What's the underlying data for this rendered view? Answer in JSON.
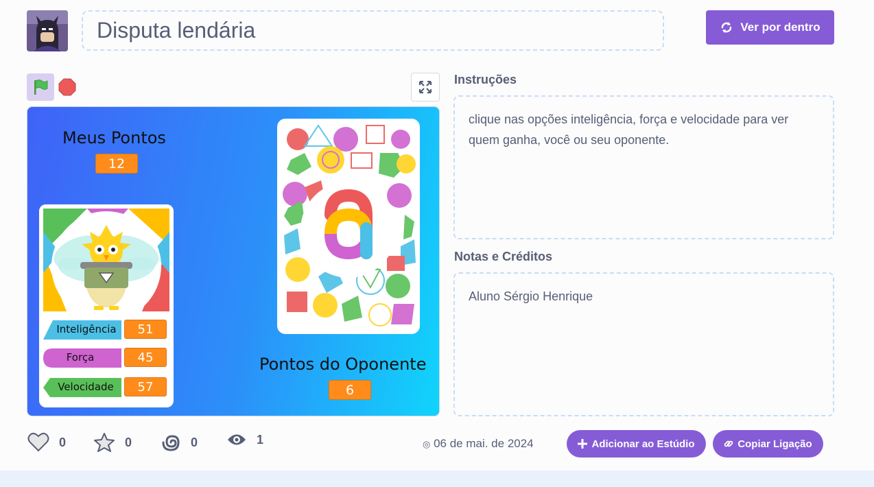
{
  "project": {
    "title": "Disputa lendária",
    "see_inside_label": "Ver por dentro"
  },
  "stage": {
    "my_points_label": "Meus Pontos",
    "my_points_value": "12",
    "opponent_points_label": "Pontos do Oponente",
    "opponent_points_value": "6",
    "attributes": [
      {
        "label": "Inteligência",
        "value": "51",
        "color": "#4cbfe6"
      },
      {
        "label": "Força",
        "value": "45",
        "color": "#cf63cf"
      },
      {
        "label": "Velocidade",
        "value": "57",
        "color": "#59c059"
      }
    ]
  },
  "instructions": {
    "heading": "Instruções",
    "text": "clique nas opções inteligência, força e velocidade para ver quem ganha, você ou seu oponente."
  },
  "notes": {
    "heading": "Notas e Créditos",
    "text": "Aluno Sérgio Henrique"
  },
  "stats": {
    "loves": "0",
    "favorites": "0",
    "remixes": "0",
    "views": "1"
  },
  "date": "06 de mai. de 2024",
  "buttons": {
    "add_to_studio": "Adicionar ao Estúdio",
    "copy_link": "Copiar Ligação"
  },
  "colors": {
    "accent": "#855cd6",
    "stage_score": "#ff8c1a"
  }
}
